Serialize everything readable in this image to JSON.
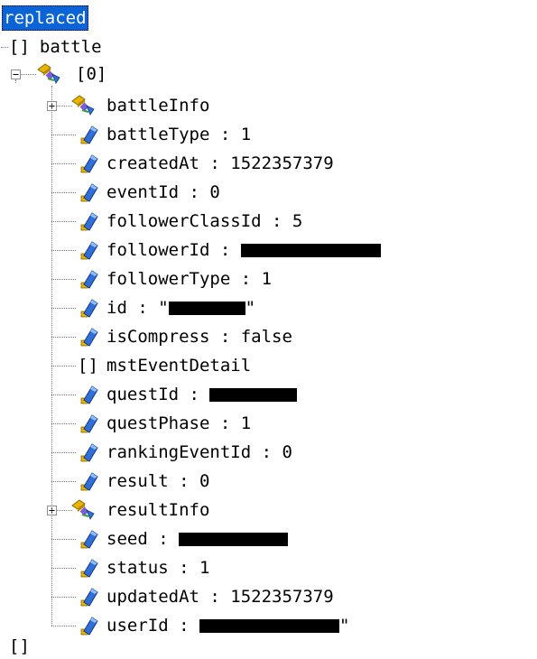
{
  "root": {
    "label": "replaced"
  },
  "battle": {
    "icon_text": "[]",
    "label": "battle"
  },
  "item0": {
    "label": "[0]"
  },
  "fields": [
    {
      "key": "battleInfo",
      "sep": "",
      "value": ""
    },
    {
      "key": "battleType",
      "sep": " : ",
      "value": "1"
    },
    {
      "key": "createdAt",
      "sep": " : ",
      "value": "1522357379"
    },
    {
      "key": "eventId",
      "sep": " : ",
      "value": "0"
    },
    {
      "key": "followerClassId",
      "sep": " : ",
      "value": "5"
    },
    {
      "key": "followerId",
      "sep": " : ",
      "value": ""
    },
    {
      "key": "followerType",
      "sep": " : ",
      "value": "1"
    },
    {
      "key": "id",
      "sep": " : ",
      "value": "\"",
      "value_end": "\""
    },
    {
      "key": "isCompress",
      "sep": " : ",
      "value": "false"
    },
    {
      "key": "mstEventDetail",
      "sep": "",
      "value": "",
      "icon_text": "[]"
    },
    {
      "key": "questId",
      "sep": " : ",
      "value": ""
    },
    {
      "key": "questPhase",
      "sep": " : ",
      "value": "1"
    },
    {
      "key": "rankingEventId",
      "sep": " : ",
      "value": "0"
    },
    {
      "key": "result",
      "sep": " : ",
      "value": "0"
    },
    {
      "key": "resultInfo",
      "sep": "",
      "value": ""
    },
    {
      "key": "seed",
      "sep": " : ",
      "value": ""
    },
    {
      "key": "status",
      "sep": " : ",
      "value": "1"
    },
    {
      "key": "updatedAt",
      "sep": " : ",
      "value": "1522357379"
    },
    {
      "key": "userId",
      "sep": " : ",
      "value": "",
      "value_end": "\""
    }
  ],
  "trailing": {
    "icon_text": "[]"
  },
  "icons": {
    "object": "object-node-icon",
    "property": "property-icon",
    "array": "array-brackets-icon"
  },
  "colors": {
    "selection": "#0a64d8",
    "icon_blue": "#2f6fd6",
    "icon_gold": "#e8b400"
  }
}
